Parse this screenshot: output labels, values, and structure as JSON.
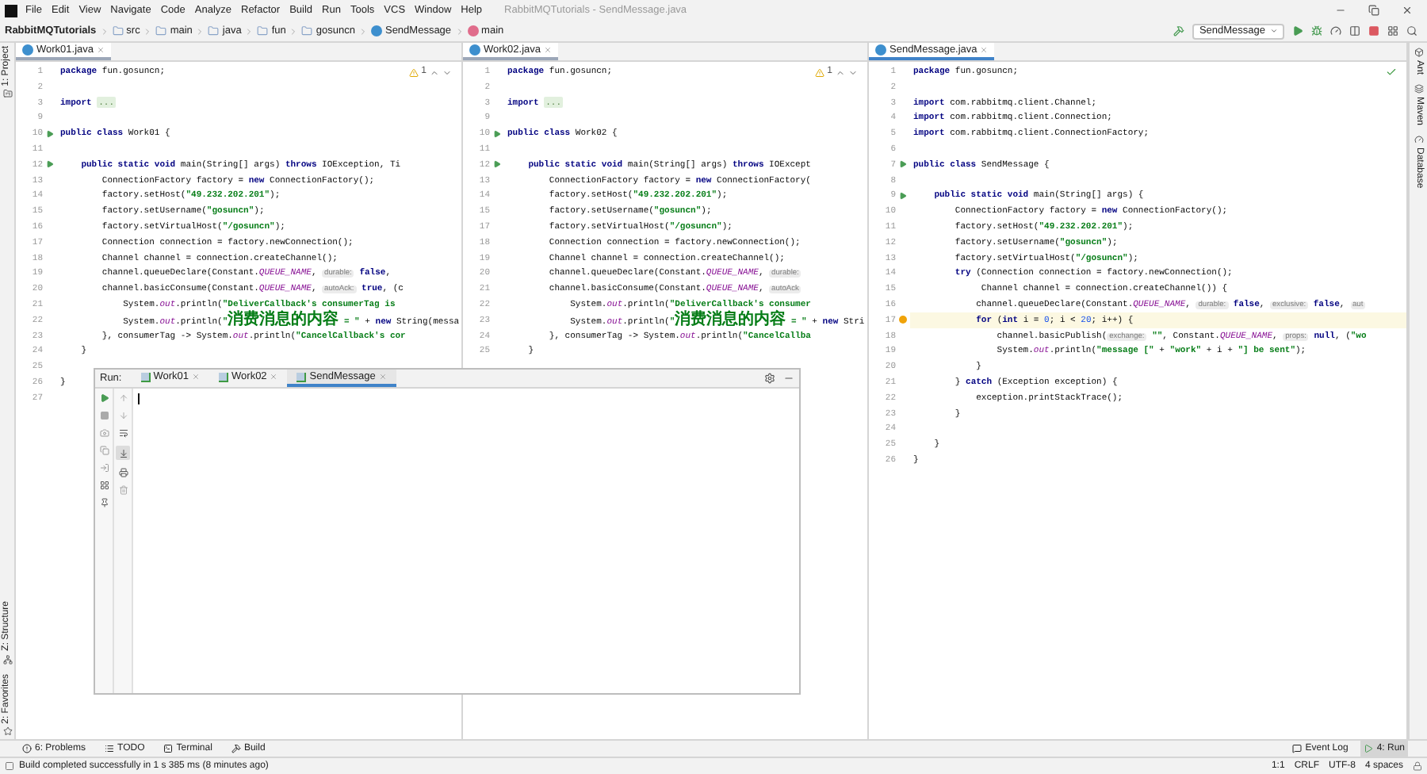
{
  "menu": {
    "items": [
      "File",
      "Edit",
      "View",
      "Navigate",
      "Code",
      "Analyze",
      "Refactor",
      "Build",
      "Run",
      "Tools",
      "VCS",
      "Window",
      "Help"
    ],
    "title": "RabbitMQTutorials - SendMessage.java"
  },
  "breadcrumbs": [
    {
      "label": "RabbitMQTutorials",
      "kind": "project"
    },
    {
      "label": "src",
      "kind": "folder"
    },
    {
      "label": "main",
      "kind": "folder"
    },
    {
      "label": "java",
      "kind": "folder"
    },
    {
      "label": "fun",
      "kind": "folder"
    },
    {
      "label": "gosuncn",
      "kind": "folder"
    },
    {
      "label": "SendMessage",
      "kind": "class"
    },
    {
      "label": "main",
      "kind": "method"
    }
  ],
  "run_config": "SendMessage",
  "left_stripe_top": [
    "1: Project"
  ],
  "left_stripe_bottom": [
    "Z: Structure",
    "2: Favorites"
  ],
  "right_stripe": [
    "Ant",
    "Maven",
    "Database"
  ],
  "editors": [
    {
      "tab": "Work01.java",
      "inspection": {
        "kind": "warning",
        "count": "1"
      },
      "lines": [
        {
          "n": "1",
          "run": false,
          "current": false,
          "tokens": [
            {
              "text": "package",
              "kind": "kw"
            },
            {
              "text": " fun.gosuncn;",
              "kind": "plain"
            }
          ]
        },
        {
          "n": "2",
          "run": false,
          "current": false
        },
        {
          "n": "3",
          "run": false,
          "current": false,
          "tokens": [
            {
              "text": "import ",
              "kind": "kw"
            },
            {
              "text": "...",
              "kind": "fold"
            }
          ]
        },
        {
          "n": "9",
          "run": false,
          "current": false
        },
        {
          "n": "10",
          "run": true,
          "current": false,
          "tokens": [
            {
              "text": "public class",
              "kind": "kw"
            },
            {
              "text": " Work01 {",
              "kind": "plain"
            }
          ]
        },
        {
          "n": "11",
          "run": false,
          "current": false
        },
        {
          "n": "12",
          "run": true,
          "current": false,
          "tokens": [
            {
              "text": "    public static void",
              "kind": "kw"
            },
            {
              "text": " main(String[] args) ",
              "kind": "plain"
            },
            {
              "text": "throws",
              "kind": "kw"
            },
            {
              "text": " IOException, Ti",
              "kind": "plain"
            }
          ]
        },
        {
          "n": "13",
          "run": false,
          "current": false,
          "tokens": [
            {
              "text": "        ConnectionFactory factory = ",
              "kind": "plain"
            },
            {
              "text": "new",
              "kind": "kw"
            },
            {
              "text": " ConnectionFactory();",
              "kind": "plain"
            }
          ]
        },
        {
          "n": "14",
          "run": false,
          "current": false,
          "tokens": [
            {
              "text": "        factory.setHost(",
              "kind": "plain"
            },
            {
              "text": "\"49.232.202.201\"",
              "kind": "str"
            },
            {
              "text": ");",
              "kind": "plain"
            }
          ]
        },
        {
          "n": "15",
          "run": false,
          "current": false,
          "tokens": [
            {
              "text": "        factory.setUsername(",
              "kind": "plain"
            },
            {
              "text": "\"gosuncn\"",
              "kind": "str"
            },
            {
              "text": ");",
              "kind": "plain"
            }
          ]
        },
        {
          "n": "16",
          "run": false,
          "current": false,
          "tokens": [
            {
              "text": "        factory.setVirtualHost(",
              "kind": "plain"
            },
            {
              "text": "\"/gosuncn\"",
              "kind": "str"
            },
            {
              "text": ");",
              "kind": "plain"
            }
          ]
        },
        {
          "n": "17",
          "run": false,
          "current": false,
          "tokens": [
            {
              "text": "        Connection connection = factory.newConnection();",
              "kind": "plain"
            }
          ]
        },
        {
          "n": "18",
          "run": false,
          "current": false,
          "tokens": [
            {
              "text": "        Channel channel = connection.createChannel();",
              "kind": "plain"
            }
          ]
        },
        {
          "n": "19",
          "run": false,
          "current": false,
          "tokens": [
            {
              "text": "        channel.queueDeclare(Constant.",
              "kind": "plain"
            },
            {
              "text": "QUEUE_NAME",
              "kind": "field"
            },
            {
              "text": ", ",
              "kind": "plain"
            },
            {
              "text": "durable:",
              "kind": "hint"
            },
            {
              "text": " false",
              "kind": "kw"
            },
            {
              "text": ",",
              "kind": "plain"
            }
          ]
        },
        {
          "n": "20",
          "run": false,
          "current": false,
          "tokens": [
            {
              "text": "        channel.basicConsume(Constant.",
              "kind": "plain"
            },
            {
              "text": "QUEUE_NAME",
              "kind": "field"
            },
            {
              "text": ", ",
              "kind": "plain"
            },
            {
              "text": "autoAck:",
              "kind": "hint"
            },
            {
              "text": " true",
              "kind": "kw"
            },
            {
              "text": ", (c",
              "kind": "plain"
            }
          ]
        },
        {
          "n": "21",
          "run": false,
          "current": false,
          "tokens": [
            {
              "text": "            System.",
              "kind": "plain"
            },
            {
              "text": "out",
              "kind": "field"
            },
            {
              "text": ".println(",
              "kind": "plain"
            },
            {
              "text": "\"DeliverCallback's consumerTag is",
              "kind": "str"
            }
          ]
        },
        {
          "n": "22",
          "run": false,
          "current": false,
          "tokens": [
            {
              "text": "            System.",
              "kind": "plain"
            },
            {
              "text": "out",
              "kind": "field"
            },
            {
              "text": ".println(",
              "kind": "plain"
            },
            {
              "text": "\"消费消息的内容 = \"",
              "kind": "str"
            },
            {
              "text": " + ",
              "kind": "plain"
            },
            {
              "text": "new",
              "kind": "kw"
            },
            {
              "text": " String(messa",
              "kind": "plain"
            }
          ]
        },
        {
          "n": "23",
          "run": false,
          "current": false,
          "tokens": [
            {
              "text": "        }, consumerTag -> System.",
              "kind": "plain"
            },
            {
              "text": "out",
              "kind": "field"
            },
            {
              "text": ".println(",
              "kind": "plain"
            },
            {
              "text": "\"CancelCallback's cor",
              "kind": "str"
            }
          ]
        },
        {
          "n": "24",
          "run": false,
          "current": false,
          "tokens": [
            {
              "text": "    }",
              "kind": "plain"
            }
          ]
        },
        {
          "n": "25",
          "run": false,
          "current": false
        },
        {
          "n": "26",
          "run": false,
          "current": false,
          "tokens": [
            {
              "text": "}",
              "kind": "plain"
            }
          ]
        },
        {
          "n": "27",
          "run": false,
          "current": false
        }
      ]
    },
    {
      "tab": "Work02.java",
      "inspection": {
        "kind": "warning",
        "count": "1"
      },
      "lines": [
        {
          "n": "1",
          "run": false,
          "current": false,
          "tokens": [
            {
              "text": "package",
              "kind": "kw"
            },
            {
              "text": " fun.gosuncn;",
              "kind": "plain"
            }
          ]
        },
        {
          "n": "2",
          "run": false,
          "current": false
        },
        {
          "n": "3",
          "run": false,
          "current": false,
          "tokens": [
            {
              "text": "import ",
              "kind": "kw"
            },
            {
              "text": "...",
              "kind": "fold"
            }
          ]
        },
        {
          "n": "9",
          "run": false,
          "current": false
        },
        {
          "n": "10",
          "run": true,
          "current": false,
          "tokens": [
            {
              "text": "public class",
              "kind": "kw"
            },
            {
              "text": " Work02 {",
              "kind": "plain"
            }
          ]
        },
        {
          "n": "11",
          "run": false,
          "current": false
        },
        {
          "n": "12",
          "run": true,
          "current": false,
          "tokens": [
            {
              "text": "    public static void",
              "kind": "kw"
            },
            {
              "text": " main(String[] args) ",
              "kind": "plain"
            },
            {
              "text": "throws",
              "kind": "kw"
            },
            {
              "text": " IOExcept",
              "kind": "plain"
            }
          ]
        },
        {
          "n": "13",
          "run": false,
          "current": false,
          "tokens": [
            {
              "text": "        ConnectionFactory factory = ",
              "kind": "plain"
            },
            {
              "text": "new",
              "kind": "kw"
            },
            {
              "text": " ConnectionFactory(",
              "kind": "plain"
            }
          ]
        },
        {
          "n": "14",
          "run": false,
          "current": false,
          "tokens": [
            {
              "text": "        factory.setHost(",
              "kind": "plain"
            },
            {
              "text": "\"49.232.202.201\"",
              "kind": "str"
            },
            {
              "text": ");",
              "kind": "plain"
            }
          ]
        },
        {
          "n": "15",
          "run": false,
          "current": false,
          "tokens": [
            {
              "text": "        factory.setUsername(",
              "kind": "plain"
            },
            {
              "text": "\"gosuncn\"",
              "kind": "str"
            },
            {
              "text": ");",
              "kind": "plain"
            }
          ]
        },
        {
          "n": "17",
          "run": false,
          "current": false,
          "tokens": [
            {
              "text": "        factory.setVirtualHost(",
              "kind": "plain"
            },
            {
              "text": "\"/gosuncn\"",
              "kind": "str"
            },
            {
              "text": ");",
              "kind": "plain"
            }
          ]
        },
        {
          "n": "18",
          "run": false,
          "current": false,
          "tokens": [
            {
              "text": "        Connection connection = factory.newConnection();",
              "kind": "plain"
            }
          ]
        },
        {
          "n": "19",
          "run": false,
          "current": false,
          "tokens": [
            {
              "text": "        Channel channel = connection.createChannel();",
              "kind": "plain"
            }
          ]
        },
        {
          "n": "20",
          "run": false,
          "current": false,
          "tokens": [
            {
              "text": "        channel.queueDeclare(Constant.",
              "kind": "plain"
            },
            {
              "text": "QUEUE_NAME",
              "kind": "field"
            },
            {
              "text": ", ",
              "kind": "plain"
            },
            {
              "text": "durable:",
              "kind": "hint"
            }
          ]
        },
        {
          "n": "21",
          "run": false,
          "current": false,
          "tokens": [
            {
              "text": "        channel.basicConsume(Constant.",
              "kind": "plain"
            },
            {
              "text": "QUEUE_NAME",
              "kind": "field"
            },
            {
              "text": ", ",
              "kind": "plain"
            },
            {
              "text": "autoAck",
              "kind": "hint"
            }
          ]
        },
        {
          "n": "22",
          "run": false,
          "current": false,
          "tokens": [
            {
              "text": "            System.",
              "kind": "plain"
            },
            {
              "text": "out",
              "kind": "field"
            },
            {
              "text": ".println(",
              "kind": "plain"
            },
            {
              "text": "\"DeliverCallback's consumer",
              "kind": "str"
            }
          ]
        },
        {
          "n": "23",
          "run": false,
          "current": false,
          "tokens": [
            {
              "text": "            System.",
              "kind": "plain"
            },
            {
              "text": "out",
              "kind": "field"
            },
            {
              "text": ".println(",
              "kind": "plain"
            },
            {
              "text": "\"消费消息的内容 = \"",
              "kind": "str"
            },
            {
              "text": " + ",
              "kind": "plain"
            },
            {
              "text": "new",
              "kind": "kw"
            },
            {
              "text": " Stri",
              "kind": "plain"
            }
          ]
        },
        {
          "n": "24",
          "run": false,
          "current": false,
          "tokens": [
            {
              "text": "        }, consumerTag -> System.",
              "kind": "plain"
            },
            {
              "text": "out",
              "kind": "field"
            },
            {
              "text": ".println(",
              "kind": "plain"
            },
            {
              "text": "\"CancelCallba",
              "kind": "str"
            }
          ]
        },
        {
          "n": "25",
          "run": false,
          "current": false,
          "tokens": [
            {
              "text": "    }",
              "kind": "plain"
            }
          ]
        }
      ]
    },
    {
      "tab": "SendMessage.java",
      "inspection": {
        "kind": "ok"
      },
      "lines": [
        {
          "n": "1",
          "run": false,
          "current": false,
          "tokens": [
            {
              "text": "package",
              "kind": "kw"
            },
            {
              "text": " fun.gosuncn;",
              "kind": "plain"
            }
          ]
        },
        {
          "n": "2",
          "run": false,
          "current": false
        },
        {
          "n": "3",
          "run": false,
          "current": false,
          "tokens": [
            {
              "text": "import",
              "kind": "kw"
            },
            {
              "text": " com.rabbitmq.client.Channel;",
              "kind": "plain"
            }
          ]
        },
        {
          "n": "4",
          "run": false,
          "current": false,
          "tokens": [
            {
              "text": "import",
              "kind": "kw"
            },
            {
              "text": " com.rabbitmq.client.Connection;",
              "kind": "plain"
            }
          ]
        },
        {
          "n": "5",
          "run": false,
          "current": false,
          "tokens": [
            {
              "text": "import",
              "kind": "kw"
            },
            {
              "text": " com.rabbitmq.client.ConnectionFactory;",
              "kind": "plain"
            }
          ]
        },
        {
          "n": "6",
          "run": false,
          "current": false
        },
        {
          "n": "7",
          "run": true,
          "current": false,
          "tokens": [
            {
              "text": "public class",
              "kind": "kw"
            },
            {
              "text": " SendMessage {",
              "kind": "plain"
            }
          ]
        },
        {
          "n": "8",
          "run": false,
          "current": false
        },
        {
          "n": "9",
          "run": true,
          "current": false,
          "tokens": [
            {
              "text": "    public static void",
              "kind": "kw"
            },
            {
              "text": " main(String[] args) {",
              "kind": "plain"
            }
          ]
        },
        {
          "n": "10",
          "run": false,
          "current": false,
          "tokens": [
            {
              "text": "        ConnectionFactory factory = ",
              "kind": "plain"
            },
            {
              "text": "new",
              "kind": "kw"
            },
            {
              "text": " ConnectionFactory();",
              "kind": "plain"
            }
          ]
        },
        {
          "n": "11",
          "run": false,
          "current": false,
          "tokens": [
            {
              "text": "        factory.setHost(",
              "kind": "plain"
            },
            {
              "text": "\"49.232.202.201\"",
              "kind": "str"
            },
            {
              "text": ");",
              "kind": "plain"
            }
          ]
        },
        {
          "n": "12",
          "run": false,
          "current": false,
          "tokens": [
            {
              "text": "        factory.setUsername(",
              "kind": "plain"
            },
            {
              "text": "\"gosuncn\"",
              "kind": "str"
            },
            {
              "text": ");",
              "kind": "plain"
            }
          ]
        },
        {
          "n": "13",
          "run": false,
          "current": false,
          "tokens": [
            {
              "text": "        factory.setVirtualHost(",
              "kind": "plain"
            },
            {
              "text": "\"/gosuncn\"",
              "kind": "str"
            },
            {
              "text": ");",
              "kind": "plain"
            }
          ]
        },
        {
          "n": "14",
          "run": false,
          "current": false,
          "tokens": [
            {
              "text": "        try",
              "kind": "kw"
            },
            {
              "text": " (Connection connection = factory.newConnection();",
              "kind": "plain"
            }
          ]
        },
        {
          "n": "15",
          "run": false,
          "current": false,
          "tokens": [
            {
              "text": "             Channel channel = connection.createChannel()) {",
              "kind": "plain"
            }
          ]
        },
        {
          "n": "16",
          "run": false,
          "current": false,
          "tokens": [
            {
              "text": "            channel.queueDeclare(Constant.",
              "kind": "plain"
            },
            {
              "text": "QUEUE_NAME",
              "kind": "field"
            },
            {
              "text": ", ",
              "kind": "plain"
            },
            {
              "text": "durable:",
              "kind": "hint"
            },
            {
              "text": " false",
              "kind": "kw"
            },
            {
              "text": ", ",
              "kind": "plain"
            },
            {
              "text": "exclusive:",
              "kind": "hint"
            },
            {
              "text": " false",
              "kind": "kw"
            },
            {
              "text": ", ",
              "kind": "plain"
            },
            {
              "text": "aut",
              "kind": "hint"
            }
          ]
        },
        {
          "n": "17",
          "run": false,
          "current": true,
          "tokens": [
            {
              "text": "            for",
              "kind": "kw"
            },
            {
              "text": " (",
              "kind": "plain"
            },
            {
              "text": "int",
              "kind": "kw"
            },
            {
              "text": " i = ",
              "kind": "plain"
            },
            {
              "text": "0",
              "kind": "num"
            },
            {
              "text": "; i < ",
              "kind": "plain"
            },
            {
              "text": "20",
              "kind": "num"
            },
            {
              "text": "; i++) {",
              "kind": "plain"
            }
          ]
        },
        {
          "n": "18",
          "run": false,
          "current": false,
          "tokens": [
            {
              "text": "                channel.basicPublish(",
              "kind": "plain"
            },
            {
              "text": "exchange:",
              "kind": "hint"
            },
            {
              "text": " \"\"",
              "kind": "str"
            },
            {
              "text": ", Constant.",
              "kind": "plain"
            },
            {
              "text": "QUEUE_NAME",
              "kind": "field"
            },
            {
              "text": ", ",
              "kind": "plain"
            },
            {
              "text": "props:",
              "kind": "hint"
            },
            {
              "text": " null",
              "kind": "kw"
            },
            {
              "text": ", (",
              "kind": "plain"
            },
            {
              "text": "\"wo",
              "kind": "str"
            }
          ]
        },
        {
          "n": "19",
          "run": false,
          "current": false,
          "tokens": [
            {
              "text": "                System.",
              "kind": "plain"
            },
            {
              "text": "out",
              "kind": "field"
            },
            {
              "text": ".println(",
              "kind": "plain"
            },
            {
              "text": "\"message [\"",
              "kind": "str"
            },
            {
              "text": " + ",
              "kind": "plain"
            },
            {
              "text": "\"work\"",
              "kind": "str"
            },
            {
              "text": " + i + ",
              "kind": "plain"
            },
            {
              "text": "\"] be sent\"",
              "kind": "str"
            },
            {
              "text": ");",
              "kind": "plain"
            }
          ]
        },
        {
          "n": "20",
          "run": false,
          "current": false,
          "tokens": [
            {
              "text": "            }",
              "kind": "plain"
            }
          ]
        },
        {
          "n": "21",
          "run": false,
          "current": false,
          "tokens": [
            {
              "text": "        } ",
              "kind": "plain"
            },
            {
              "text": "catch",
              "kind": "kw"
            },
            {
              "text": " (Exception exception) {",
              "kind": "plain"
            }
          ]
        },
        {
          "n": "22",
          "run": false,
          "current": false,
          "tokens": [
            {
              "text": "            exception.printStackTrace();",
              "kind": "plain"
            }
          ]
        },
        {
          "n": "23",
          "run": false,
          "current": false,
          "tokens": [
            {
              "text": "        }",
              "kind": "plain"
            }
          ]
        },
        {
          "n": "24",
          "run": false,
          "current": false
        },
        {
          "n": "25",
          "run": false,
          "current": false,
          "tokens": [
            {
              "text": "    }",
              "kind": "plain"
            }
          ]
        },
        {
          "n": "26",
          "run": false,
          "current": false,
          "tokens": [
            {
              "text": "}",
              "kind": "plain"
            }
          ]
        }
      ]
    }
  ],
  "run_panel": {
    "label": "Run:",
    "tabs": [
      {
        "label": "Work01",
        "selected": false
      },
      {
        "label": "Work02",
        "selected": false
      },
      {
        "label": "SendMessage",
        "selected": true
      }
    ],
    "scroll_to_end": {
      "on": true
    }
  },
  "tool_buttons_left": [
    {
      "label": "6: Problems",
      "selected": false
    },
    {
      "label": "TODO",
      "selected": false
    },
    {
      "label": "Terminal",
      "selected": false
    },
    {
      "label": "Build",
      "selected": false
    }
  ],
  "tool_buttons_right": [
    {
      "label": "Event Log",
      "selected": false
    },
    {
      "label": "4: Run",
      "selected": true
    }
  ],
  "status": {
    "message": "Build completed successfully in 1 s 385 ms (8 minutes ago)",
    "items": [
      "1:1",
      "CRLF",
      "UTF-8",
      "4 spaces"
    ]
  }
}
